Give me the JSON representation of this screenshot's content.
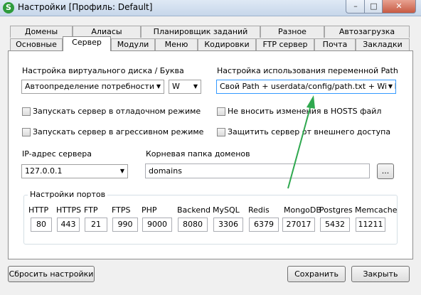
{
  "window": {
    "title": "Настройки [Профиль: Default]",
    "icon_letter": "S",
    "controls": {
      "minimize": "–",
      "maximize": "□",
      "close": "✕"
    }
  },
  "tabs_row1": [
    {
      "label": "Домены"
    },
    {
      "label": "Алиасы"
    },
    {
      "label": "Планировщик заданий"
    },
    {
      "label": "Разное"
    },
    {
      "label": "Автозагрузка"
    }
  ],
  "tabs_row2": [
    {
      "label": "Основные"
    },
    {
      "label": "Сервер",
      "active": true
    },
    {
      "label": "Модули"
    },
    {
      "label": "Меню"
    },
    {
      "label": "Кодировки"
    },
    {
      "label": "FTP сервер"
    },
    {
      "label": "Почта"
    },
    {
      "label": "Закладки"
    }
  ],
  "server": {
    "vdisk_label": "Настройка виртуального диска / Буква",
    "vdisk_mode": "Автоопределение потребности",
    "vdisk_letter": "W",
    "path_label": "Настройка использования переменной Path",
    "path_value": "Свой Path + userdata/config/path.txt + Win Path",
    "checkboxes": [
      {
        "label": "Запускать сервер в отладочном режиме",
        "checked": false
      },
      {
        "label": "Не вносить изменения в HOSTS файл",
        "checked": false
      },
      {
        "label": "Запускать сервер в агрессивном режиме",
        "checked": false
      },
      {
        "label": "Защитить сервер от внешнего доступа",
        "checked": false
      }
    ],
    "ip_label": "IP-адрес сервера",
    "ip_value": "127.0.0.1",
    "root_label": "Корневая папка доменов",
    "root_value": "domains",
    "browse_label": "...",
    "ports_title": "Настройки портов",
    "ports": [
      {
        "name": "HTTP",
        "value": "80"
      },
      {
        "name": "HTTPS",
        "value": "443"
      },
      {
        "name": "FTP",
        "value": "21"
      },
      {
        "name": "FTPS",
        "value": "990"
      },
      {
        "name": "PHP",
        "value": "9000"
      },
      {
        "name": "Backend",
        "value": "8080"
      },
      {
        "name": "MySQL",
        "value": "3306"
      },
      {
        "name": "Redis",
        "value": "6379"
      },
      {
        "name": "MongoDB",
        "value": "27017"
      },
      {
        "name": "Postgres",
        "value": "5432"
      },
      {
        "name": "Memcache",
        "value": "11211"
      }
    ]
  },
  "footer": {
    "reset": "Сбросить настройки",
    "save": "Сохранить",
    "close": "Закрыть"
  },
  "colors": {
    "annotation_arrow": "#2fa84f",
    "combo_highlight": "#3399ff"
  }
}
